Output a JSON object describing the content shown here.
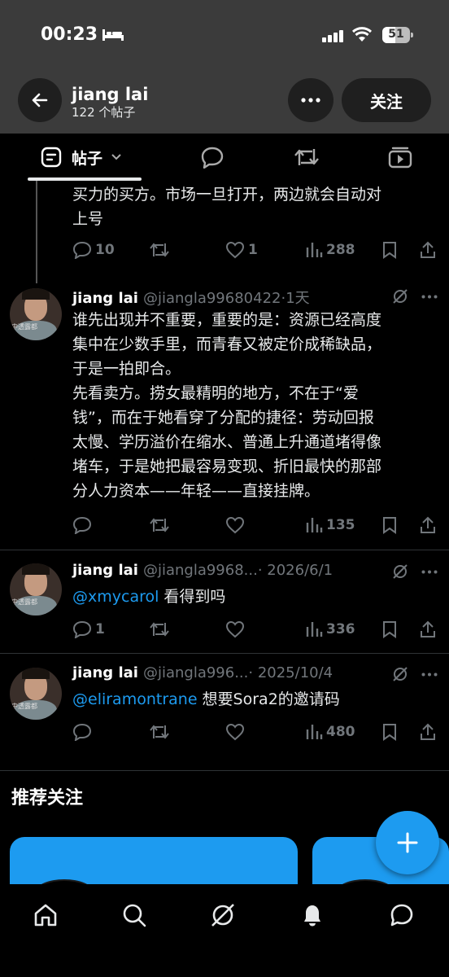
{
  "status_bar": {
    "time": "00:23",
    "battery": "51"
  },
  "profile": {
    "name": "jiang lai",
    "post_count": "122 个帖子",
    "follow_label": "关注"
  },
  "tabs": {
    "posts_label": "帖子"
  },
  "tweets": [
    {
      "text_lines": [
        "买力的买方。市场一旦打开，两边就会自动对",
        "上号"
      ],
      "replies": "10",
      "retweets": "",
      "likes": "1",
      "views": "288"
    },
    {
      "name": "jiang lai",
      "handle": "@jiangla99680422",
      "time": "·1天",
      "text_lines": [
        "谁先出现并不重要，重要的是：资源已经高度",
        "集中在少数手里，而青春又被定价成稀缺品，",
        "于是一拍即合。",
        "先看卖方。捞女最精明的地方，不在于“爱",
        "钱”，而在于她看穿了分配的捷径：劳动回报",
        "太慢、学历溢价在缩水、普通上升通道堵得像",
        "堵车，于是她把最容易变现、折旧最快的那部",
        "分人力资本——年轻——直接挂牌。"
      ],
      "replies": "",
      "retweets": "",
      "likes": "",
      "views": "135"
    },
    {
      "name": "jiang lai",
      "handle": "@jiangla9968...",
      "time": "· 2026/6/1",
      "mention": "@xmycarol",
      "text": " 看得到吗",
      "replies": "1",
      "retweets": "",
      "likes": "",
      "views": "336"
    },
    {
      "name": "jiang lai",
      "handle": "@jiangla996...",
      "time": "· 2025/10/4",
      "mention": "@eliramontrane",
      "text": " 想要Sora2的邀请码",
      "replies": "",
      "retweets": "",
      "likes": "",
      "views": "480"
    }
  ],
  "recommend": {
    "title": "推荐关注"
  },
  "colors": {
    "accent": "#1d9bf0",
    "header_bg": "#3b3b3b",
    "muted": "#71767b"
  },
  "icons": [
    "back-arrow-icon",
    "more-icon",
    "posts-tab-icon",
    "chevron-down-icon",
    "reply-icon",
    "retweet-icon",
    "video-icon",
    "like-icon",
    "views-icon",
    "bookmark-icon",
    "share-icon",
    "grok-icon",
    "home-icon",
    "search-icon",
    "notifications-icon",
    "messages-icon",
    "compose-icon"
  ]
}
